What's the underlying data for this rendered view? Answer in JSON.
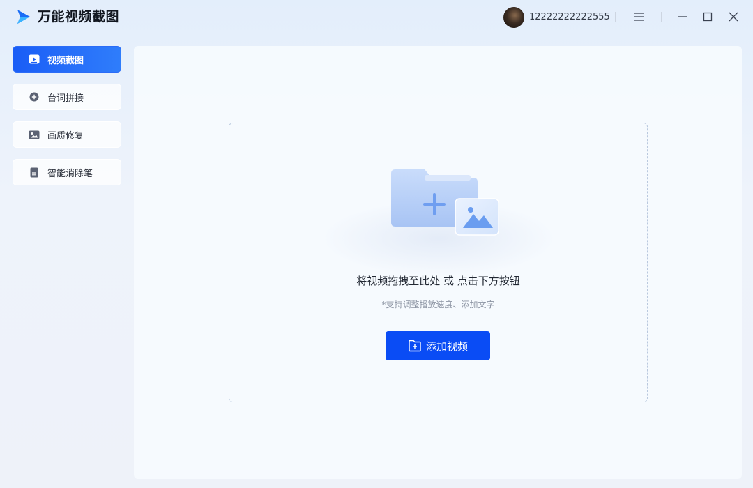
{
  "app": {
    "title": "万能视频截图",
    "logo_icon": "play-logo-icon",
    "accent_color": "#0a4cf5"
  },
  "header": {
    "user_id": "12222222222555",
    "avatar_icon": "user-avatar",
    "menu_icon": "hamburger-menu-icon",
    "minimize_icon": "minimize-icon",
    "maximize_icon": "maximize-icon",
    "close_icon": "close-icon"
  },
  "sidebar": {
    "items": [
      {
        "label": "视频截图",
        "icon": "video-screenshot-icon",
        "active": true
      },
      {
        "label": "台词拼接",
        "icon": "plus-circle-icon",
        "active": false
      },
      {
        "label": "画质修复",
        "icon": "image-icon",
        "active": false
      },
      {
        "label": "智能消除笔",
        "icon": "document-icon",
        "active": false
      }
    ]
  },
  "main": {
    "drop_text": "将视频拖拽至此处 或 点击下方按钮",
    "hint_text": "*支持调整播放速度、添加文字",
    "add_button_label": "添加视频",
    "add_button_icon": "folder-plus-icon",
    "illustration_icon": "folder-image-illustration"
  }
}
